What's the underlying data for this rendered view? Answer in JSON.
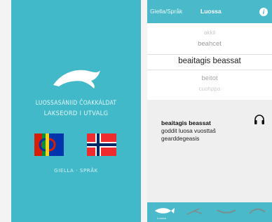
{
  "splash": {
    "title_line1": "LUOSSASÁNIID ČOAKKÁLDAT",
    "title_line2": "LAKSEORD I UTVALG",
    "language_label": "GIELLA · SPRÅK",
    "flags": [
      "sami-flag",
      "norway-flag"
    ]
  },
  "app": {
    "tab_language": "Giella/Språk",
    "tab_fish": "Luossa",
    "info_label": "i"
  },
  "picker": {
    "items": [
      "akkil",
      "beahcet",
      "beaitagis beassat",
      "beitot",
      "cuohppa"
    ],
    "selected": "beaitagis beassat"
  },
  "detail": {
    "word": "beaitagis beassat",
    "definition": "goddit luosa vuosttaš gearddegeasis",
    "audio_icon": "headphones-icon"
  },
  "tabbar": {
    "items": [
      {
        "icon": "salmon-icon",
        "label": "Luossa"
      },
      {
        "icon": "fishing-icon",
        "label": ""
      },
      {
        "icon": "boat-icon",
        "label": ""
      },
      {
        "icon": "net-icon",
        "label": ""
      }
    ]
  },
  "colors": {
    "accent": "#4ab9c9",
    "splash_bg": "#42b9c9"
  }
}
